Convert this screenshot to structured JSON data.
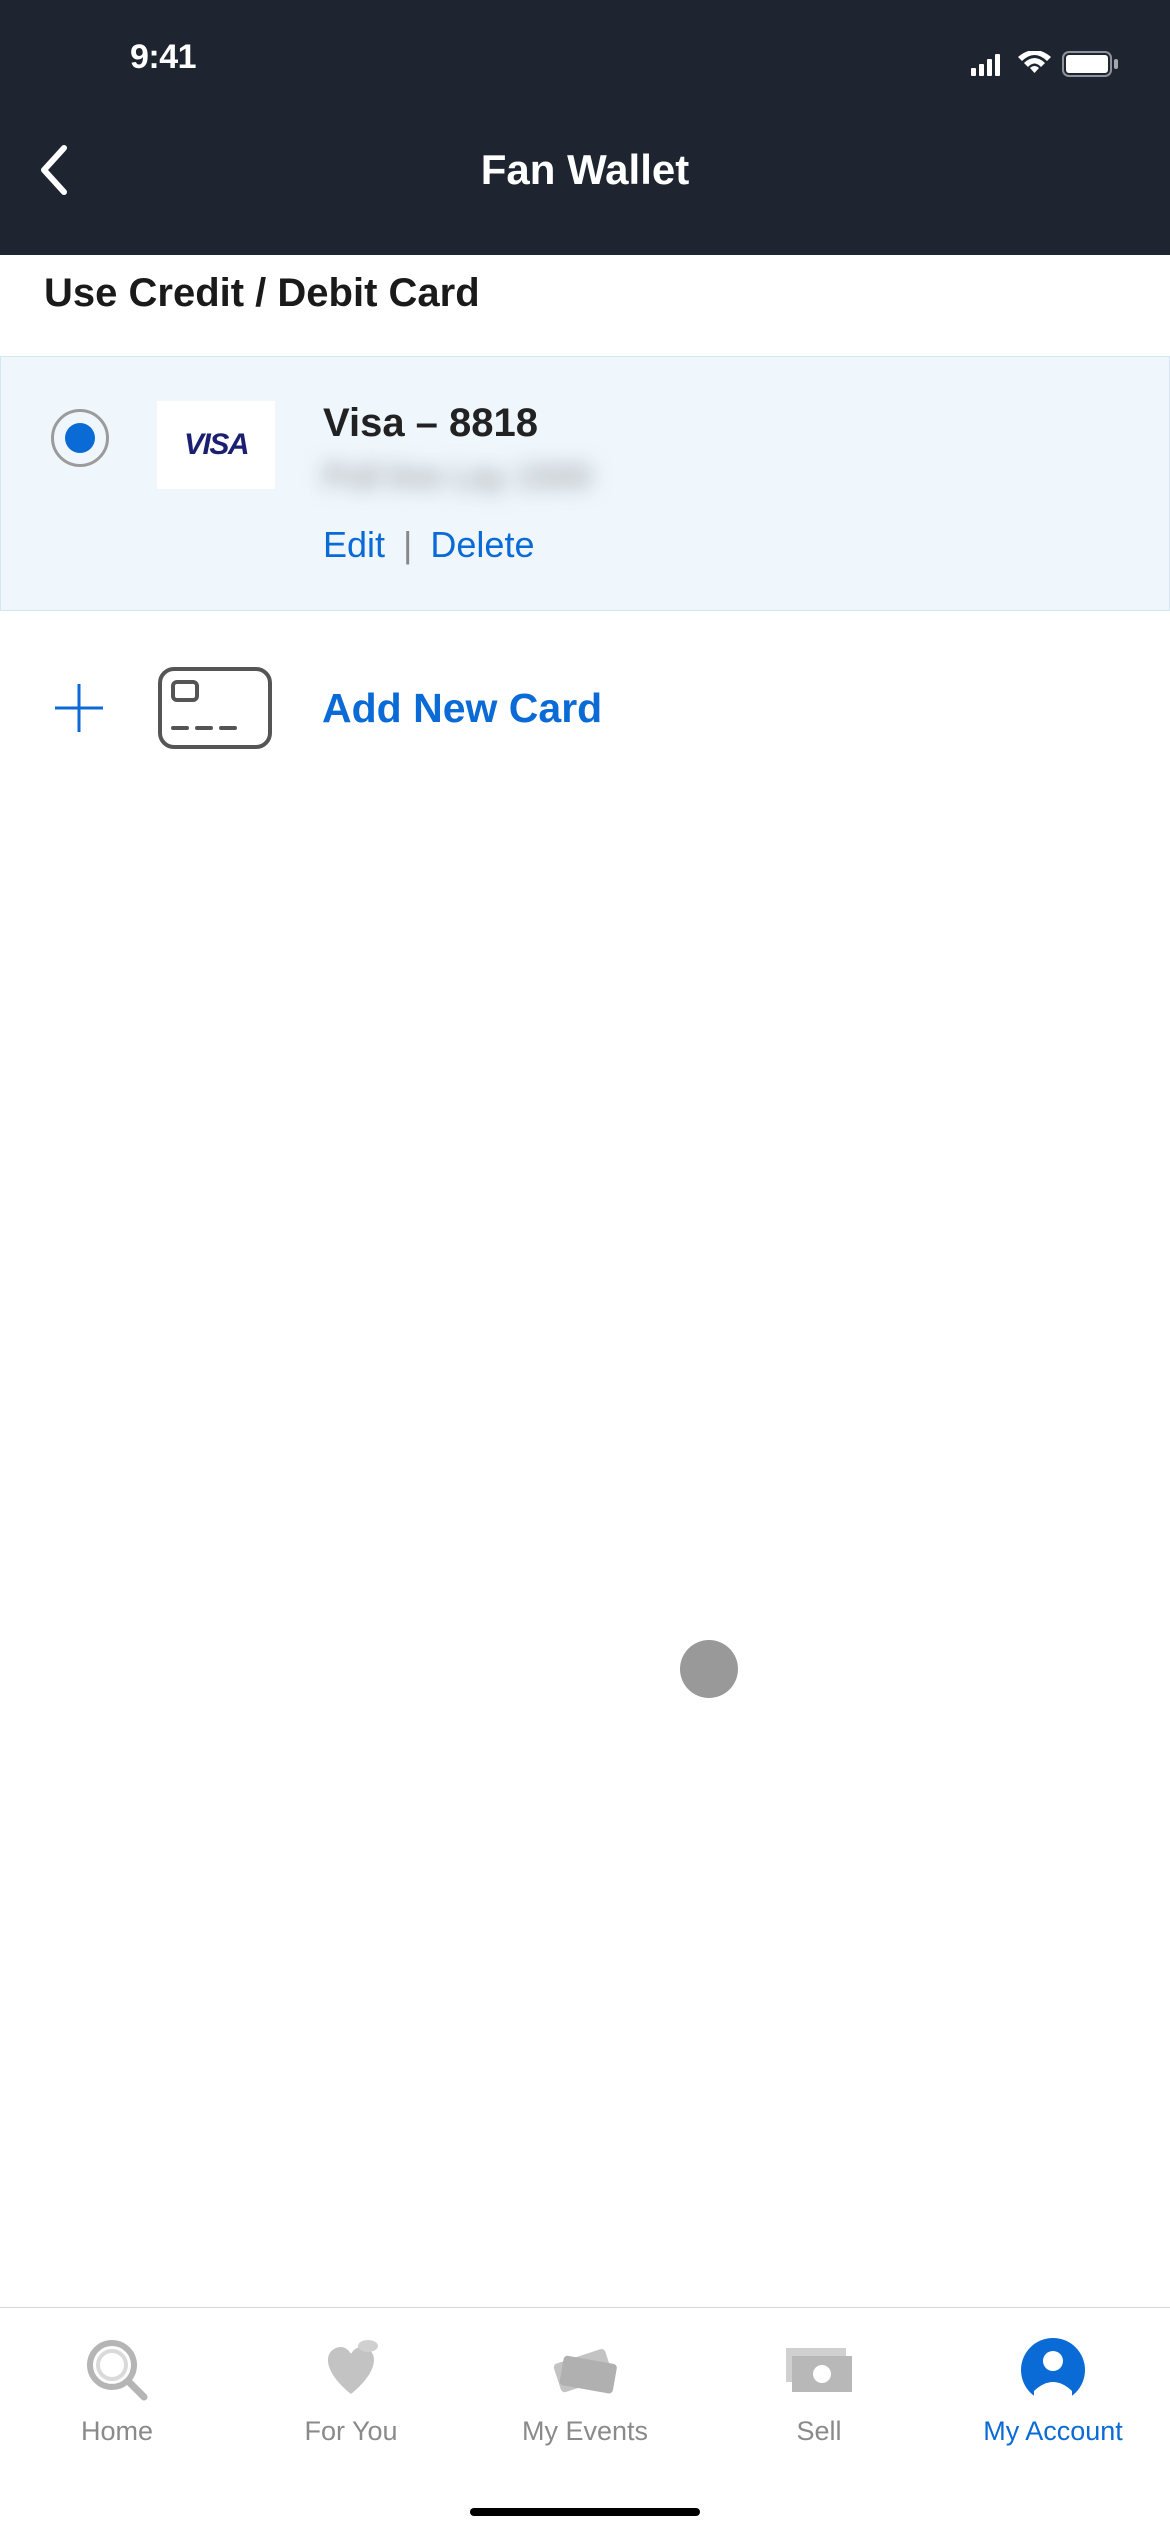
{
  "statusBar": {
    "time": "9:41"
  },
  "header": {
    "title": "Fan Wallet"
  },
  "sectionTitle": "Use Credit / Debit Card",
  "card": {
    "brand": "VISA",
    "title": "Visa – 8818",
    "subtitle": "Poll line   Lay 1500",
    "editLabel": "Edit",
    "deleteLabel": "Delete",
    "pipe": "|"
  },
  "addNew": {
    "label": "Add New Card"
  },
  "tabs": {
    "home": "Home",
    "forYou": "For You",
    "myEvents": "My Events",
    "sell": "Sell",
    "myAccount": "My Account"
  }
}
